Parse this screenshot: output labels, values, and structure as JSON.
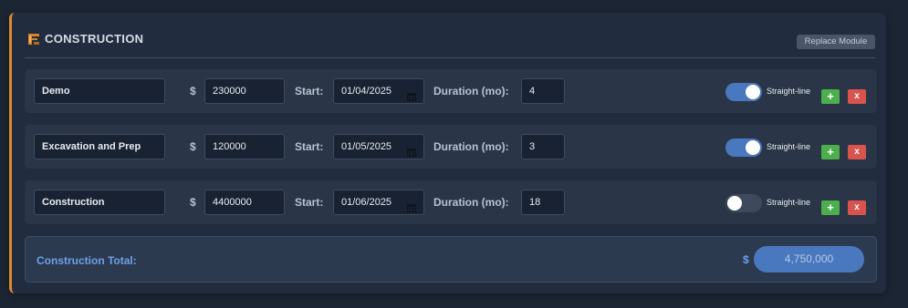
{
  "module": {
    "title": "CONSTRUCTION",
    "replace_label": "Replace Module",
    "accent_color": "#e08a2c"
  },
  "labels": {
    "currency": "$",
    "start": "Start:",
    "duration": "Duration (mo):",
    "mode": "Straight-line",
    "add": "+",
    "delete": "x"
  },
  "rows": [
    {
      "name": "Demo",
      "amount": "230000",
      "start": "01/04/2025",
      "duration": "4",
      "straight_line": true
    },
    {
      "name": "Excavation and Prep",
      "amount": "120000",
      "start": "01/05/2025",
      "duration": "3",
      "straight_line": true
    },
    {
      "name": "Construction",
      "amount": "4400000",
      "start": "01/06/2025",
      "duration": "18",
      "straight_line": false
    }
  ],
  "total": {
    "label": "Construction Total:",
    "currency": "$",
    "value": "4,750,000"
  },
  "icons": {
    "module": "construction-icon",
    "calendar": "calendar-icon"
  }
}
